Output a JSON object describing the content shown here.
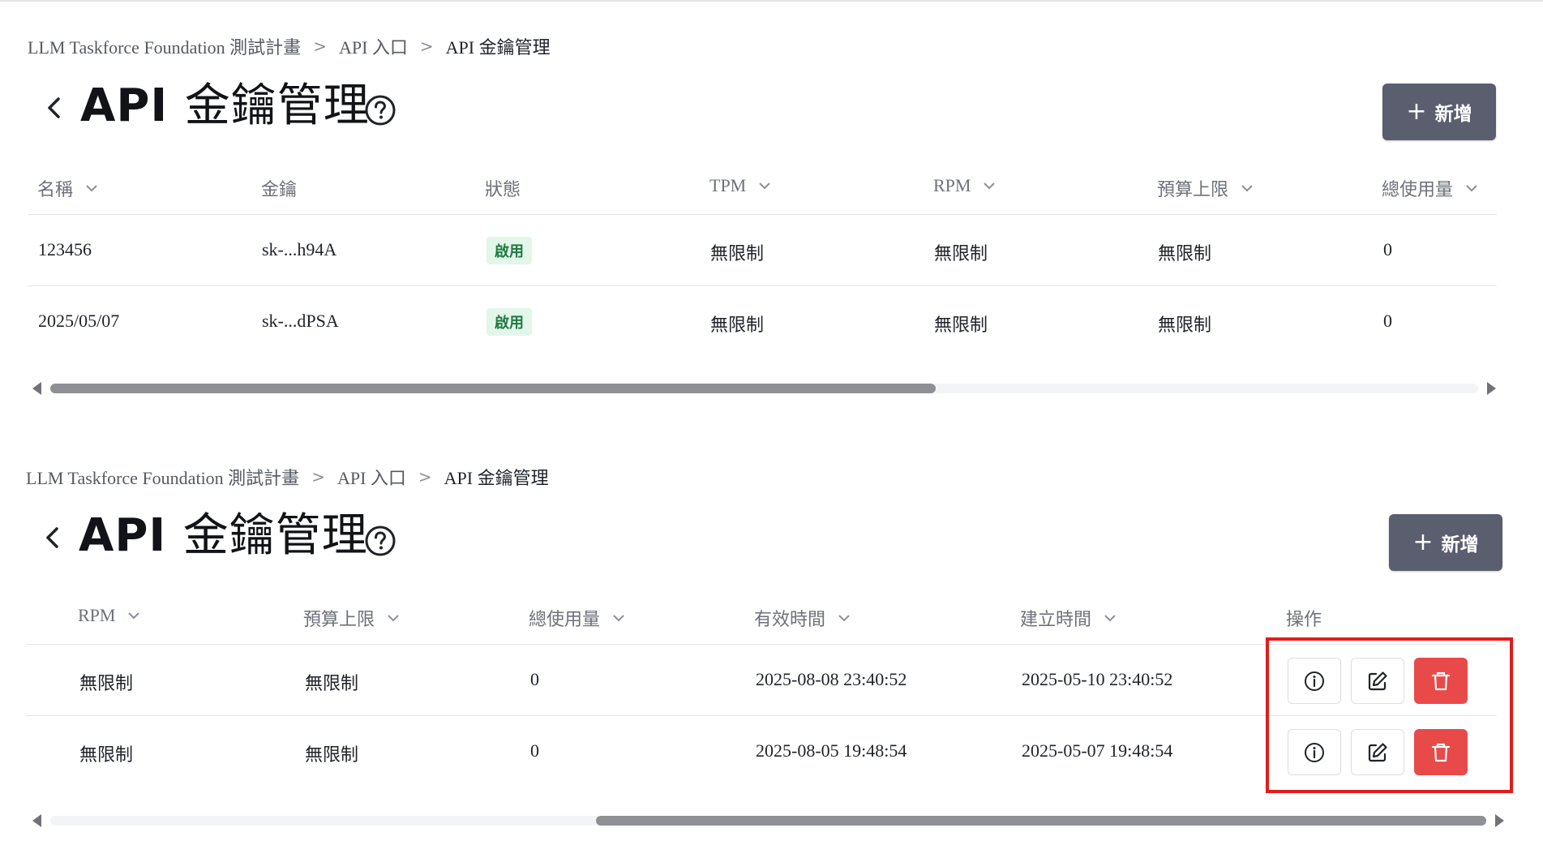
{
  "breadcrumb": {
    "items": [
      "LLM Taskforce Foundation 測試計畫",
      "API 入口",
      "API 金鑰管理"
    ],
    "separator": ">"
  },
  "page": {
    "title_latin": "API",
    "title_cjk": "金鑰管理",
    "add_button_label": "新增",
    "add_button_icon": "plus-icon"
  },
  "panel_top": {
    "columns": [
      {
        "label": "名稱",
        "sortable": true
      },
      {
        "label": "金鑰",
        "sortable": false
      },
      {
        "label": "狀態",
        "sortable": false
      },
      {
        "label": "TPM",
        "sortable": true
      },
      {
        "label": "RPM",
        "sortable": true
      },
      {
        "label": "預算上限",
        "sortable": true
      },
      {
        "label": "總使用量",
        "sortable": true
      }
    ],
    "rows": [
      {
        "name": "123456",
        "key": "sk-...h94A",
        "status": "啟用",
        "tpm": "無限制",
        "rpm": "無限制",
        "budget": "無限制",
        "usage": "0"
      },
      {
        "name": "2025/05/07",
        "key": "sk-...dPSA",
        "status": "啟用",
        "tpm": "無限制",
        "rpm": "無限制",
        "budget": "無限制",
        "usage": "0"
      }
    ],
    "scroll_position": 0.0,
    "scroll_visible_fraction": 0.62
  },
  "panel_bottom": {
    "columns": [
      {
        "label": "RPM",
        "sortable": true
      },
      {
        "label": "預算上限",
        "sortable": true
      },
      {
        "label": "總使用量",
        "sortable": true
      },
      {
        "label": "有效時間",
        "sortable": true
      },
      {
        "label": "建立時間",
        "sortable": true
      },
      {
        "label": "操作",
        "sortable": false
      }
    ],
    "rows": [
      {
        "rpm": "無限制",
        "budget": "無限制",
        "usage": "0",
        "valid_until": "2025-08-08 23:40:52",
        "created": "2025-05-10 23:40:52"
      },
      {
        "rpm": "無限制",
        "budget": "無限制",
        "usage": "0",
        "valid_until": "2025-08-05 19:48:54",
        "created": "2025-05-07 19:48:54"
      }
    ],
    "actions": [
      "info-icon",
      "edit-icon",
      "trash-icon"
    ],
    "scroll_position": 1.0,
    "scroll_visible_fraction": 0.62
  },
  "colors": {
    "primary_button": "#5b5e6f",
    "danger": "#e84a4a",
    "badge_bg": "#e3f6ea",
    "badge_text": "#207a44",
    "highlight": "#e11c1c"
  }
}
